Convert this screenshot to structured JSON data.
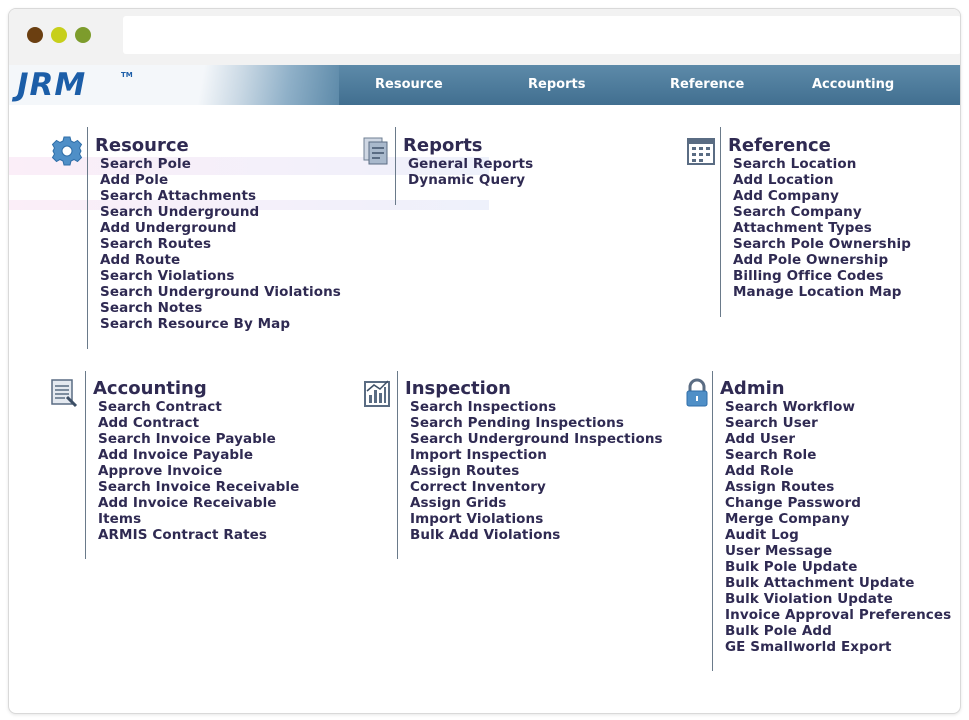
{
  "colors": {
    "nav_bar": "#4f7d9f",
    "link_text": "#2f2a52",
    "logo_blue": "#1c5ea8",
    "dot_brown": "#6b3f11",
    "dot_yellow": "#c7cf1b",
    "dot_green": "#7d9c2c"
  },
  "brand": {
    "logo": "JRM",
    "tm": "TM"
  },
  "nav": [
    {
      "label": "Resource"
    },
    {
      "label": "Reports"
    },
    {
      "label": "Reference"
    },
    {
      "label": "Accounting"
    }
  ],
  "sections": {
    "resource": {
      "icon": "gear-icon",
      "title": "Resource",
      "links": [
        "Search Pole",
        "Add Pole",
        "Search Attachments",
        "Search Underground",
        "Add Underground",
        "Search Routes",
        "Add Route",
        "Search Violations",
        "Search Underground Violations",
        "Search Notes",
        "Search Resource By Map"
      ]
    },
    "reports": {
      "icon": "document-icon",
      "title": "Reports",
      "links": [
        "General Reports",
        "Dynamic Query"
      ]
    },
    "reference": {
      "icon": "calendar-icon",
      "title": "Reference",
      "links": [
        "Search Location",
        "Add Location",
        "Add Company",
        "Search Company",
        "Attachment Types",
        "Search Pole Ownership",
        "Add Pole Ownership",
        "Billing Office Codes",
        "Manage Location Map"
      ]
    },
    "accounting": {
      "icon": "ledger-icon",
      "title": "Accounting",
      "links": [
        "Search Contract",
        "Add Contract",
        "Search Invoice Payable",
        "Add Invoice Payable",
        "Approve Invoice",
        "Search Invoice Receivable",
        "Add Invoice Receivable",
        "Items",
        "ARMIS Contract Rates"
      ]
    },
    "inspection": {
      "icon": "clipboard-chart-icon",
      "title": "Inspection",
      "links": [
        "Search Inspections",
        "Search Pending Inspections",
        "Search Underground Inspections",
        "Import Inspection",
        "Assign Routes",
        "Correct Inventory",
        "Assign Grids",
        "Import Violations",
        "Bulk Add Violations"
      ]
    },
    "admin": {
      "icon": "lock-icon",
      "title": "Admin",
      "links": [
        "Search Workflow",
        "Search User",
        "Add User",
        "Search Role",
        "Add Role",
        "Assign Routes",
        "Change Password",
        "Merge Company",
        "Audit Log",
        "User Message",
        "Bulk Pole Update",
        "Bulk Attachment Update",
        "Bulk Violation Update",
        "Invoice Approval Preferences",
        "Bulk Pole Add",
        "GE Smallworld Export"
      ]
    }
  }
}
